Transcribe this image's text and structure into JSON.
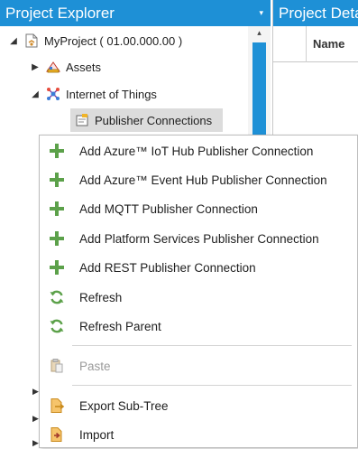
{
  "explorer": {
    "title": "Project Explorer",
    "menu_arrow": "▾",
    "scroll_up": "▴",
    "tree": {
      "project": "MyProject ( 01.00.000.00 )",
      "assets": "Assets",
      "iot": "Internet of Things",
      "publishers": "Publisher Connections"
    }
  },
  "details": {
    "title": "Project Details",
    "column_name": "Name"
  },
  "context_menu": {
    "items": [
      {
        "label": "Add Azure™ IoT Hub Publisher Connection",
        "icon": "plus-icon"
      },
      {
        "label": "Add Azure™ Event Hub Publisher Connection",
        "icon": "plus-icon"
      },
      {
        "label": "Add MQTT Publisher Connection",
        "icon": "plus-icon"
      },
      {
        "label": "Add Platform Services Publisher Connection",
        "icon": "plus-icon"
      },
      {
        "label": "Add REST Publisher Connection",
        "icon": "plus-icon"
      },
      {
        "label": "Refresh",
        "icon": "refresh-icon"
      },
      {
        "label": "Refresh Parent",
        "icon": "refresh-icon"
      },
      {
        "label": "Paste",
        "icon": "paste-icon",
        "disabled": true
      },
      {
        "label": "Export Sub-Tree",
        "icon": "export-icon"
      },
      {
        "label": "Import",
        "icon": "import-icon"
      }
    ]
  },
  "colors": {
    "accent": "#1e90d6",
    "plus_green": "#5ca14a",
    "selection": "#dcdcdc"
  }
}
